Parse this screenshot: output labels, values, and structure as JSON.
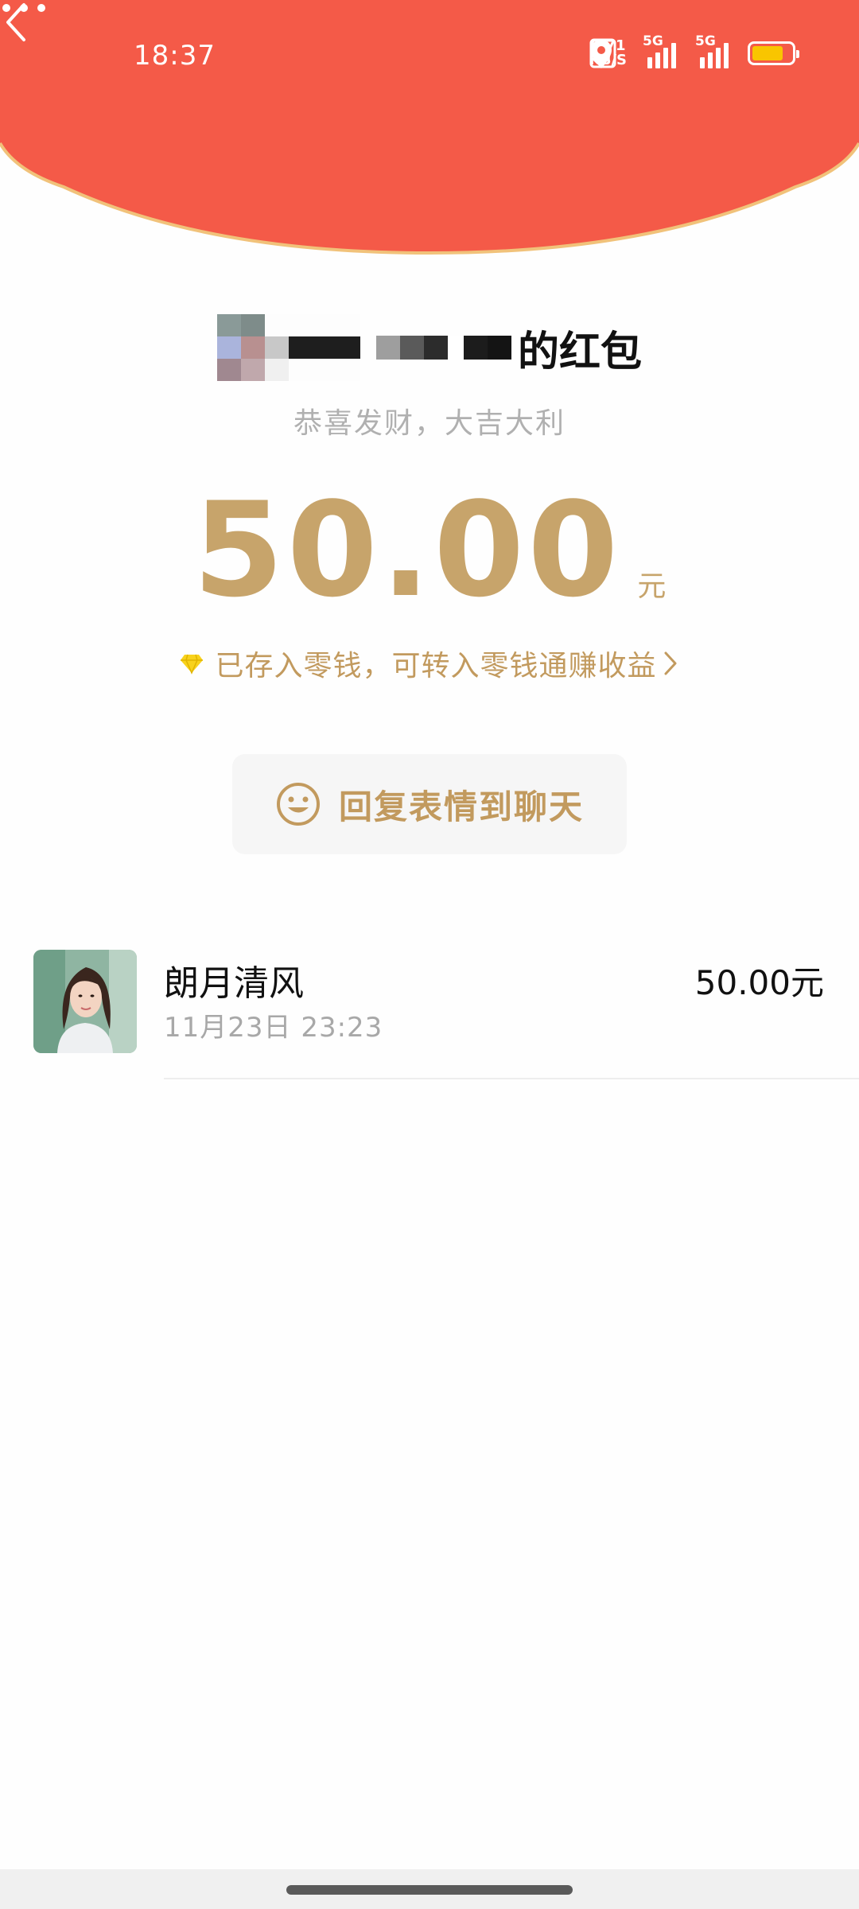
{
  "status_bar": {
    "time": "18:37",
    "net_speed_value": "0.71",
    "net_speed_unit": "KB/S",
    "signal1_label": "5G",
    "signal2_label": "5G",
    "battery_color": "#f9c500"
  },
  "header": {
    "background_color": "#f45a48",
    "border_color": "#f1c27a",
    "back_icon": "chevron-left-icon",
    "more_icon": "more-horizontal-icon"
  },
  "packet": {
    "sender_suffix": "的红包",
    "greeting": "恭喜发财，大吉大利",
    "amount": "50.00",
    "currency": "元",
    "note": "已存入零钱，可转入零钱通赚收益",
    "reply_label": "回复表情到聊天",
    "accent_color": "#c7a46b"
  },
  "records": [
    {
      "name": "朗月清风",
      "time": "11月23日  23:23",
      "amount": "50.00元"
    }
  ]
}
